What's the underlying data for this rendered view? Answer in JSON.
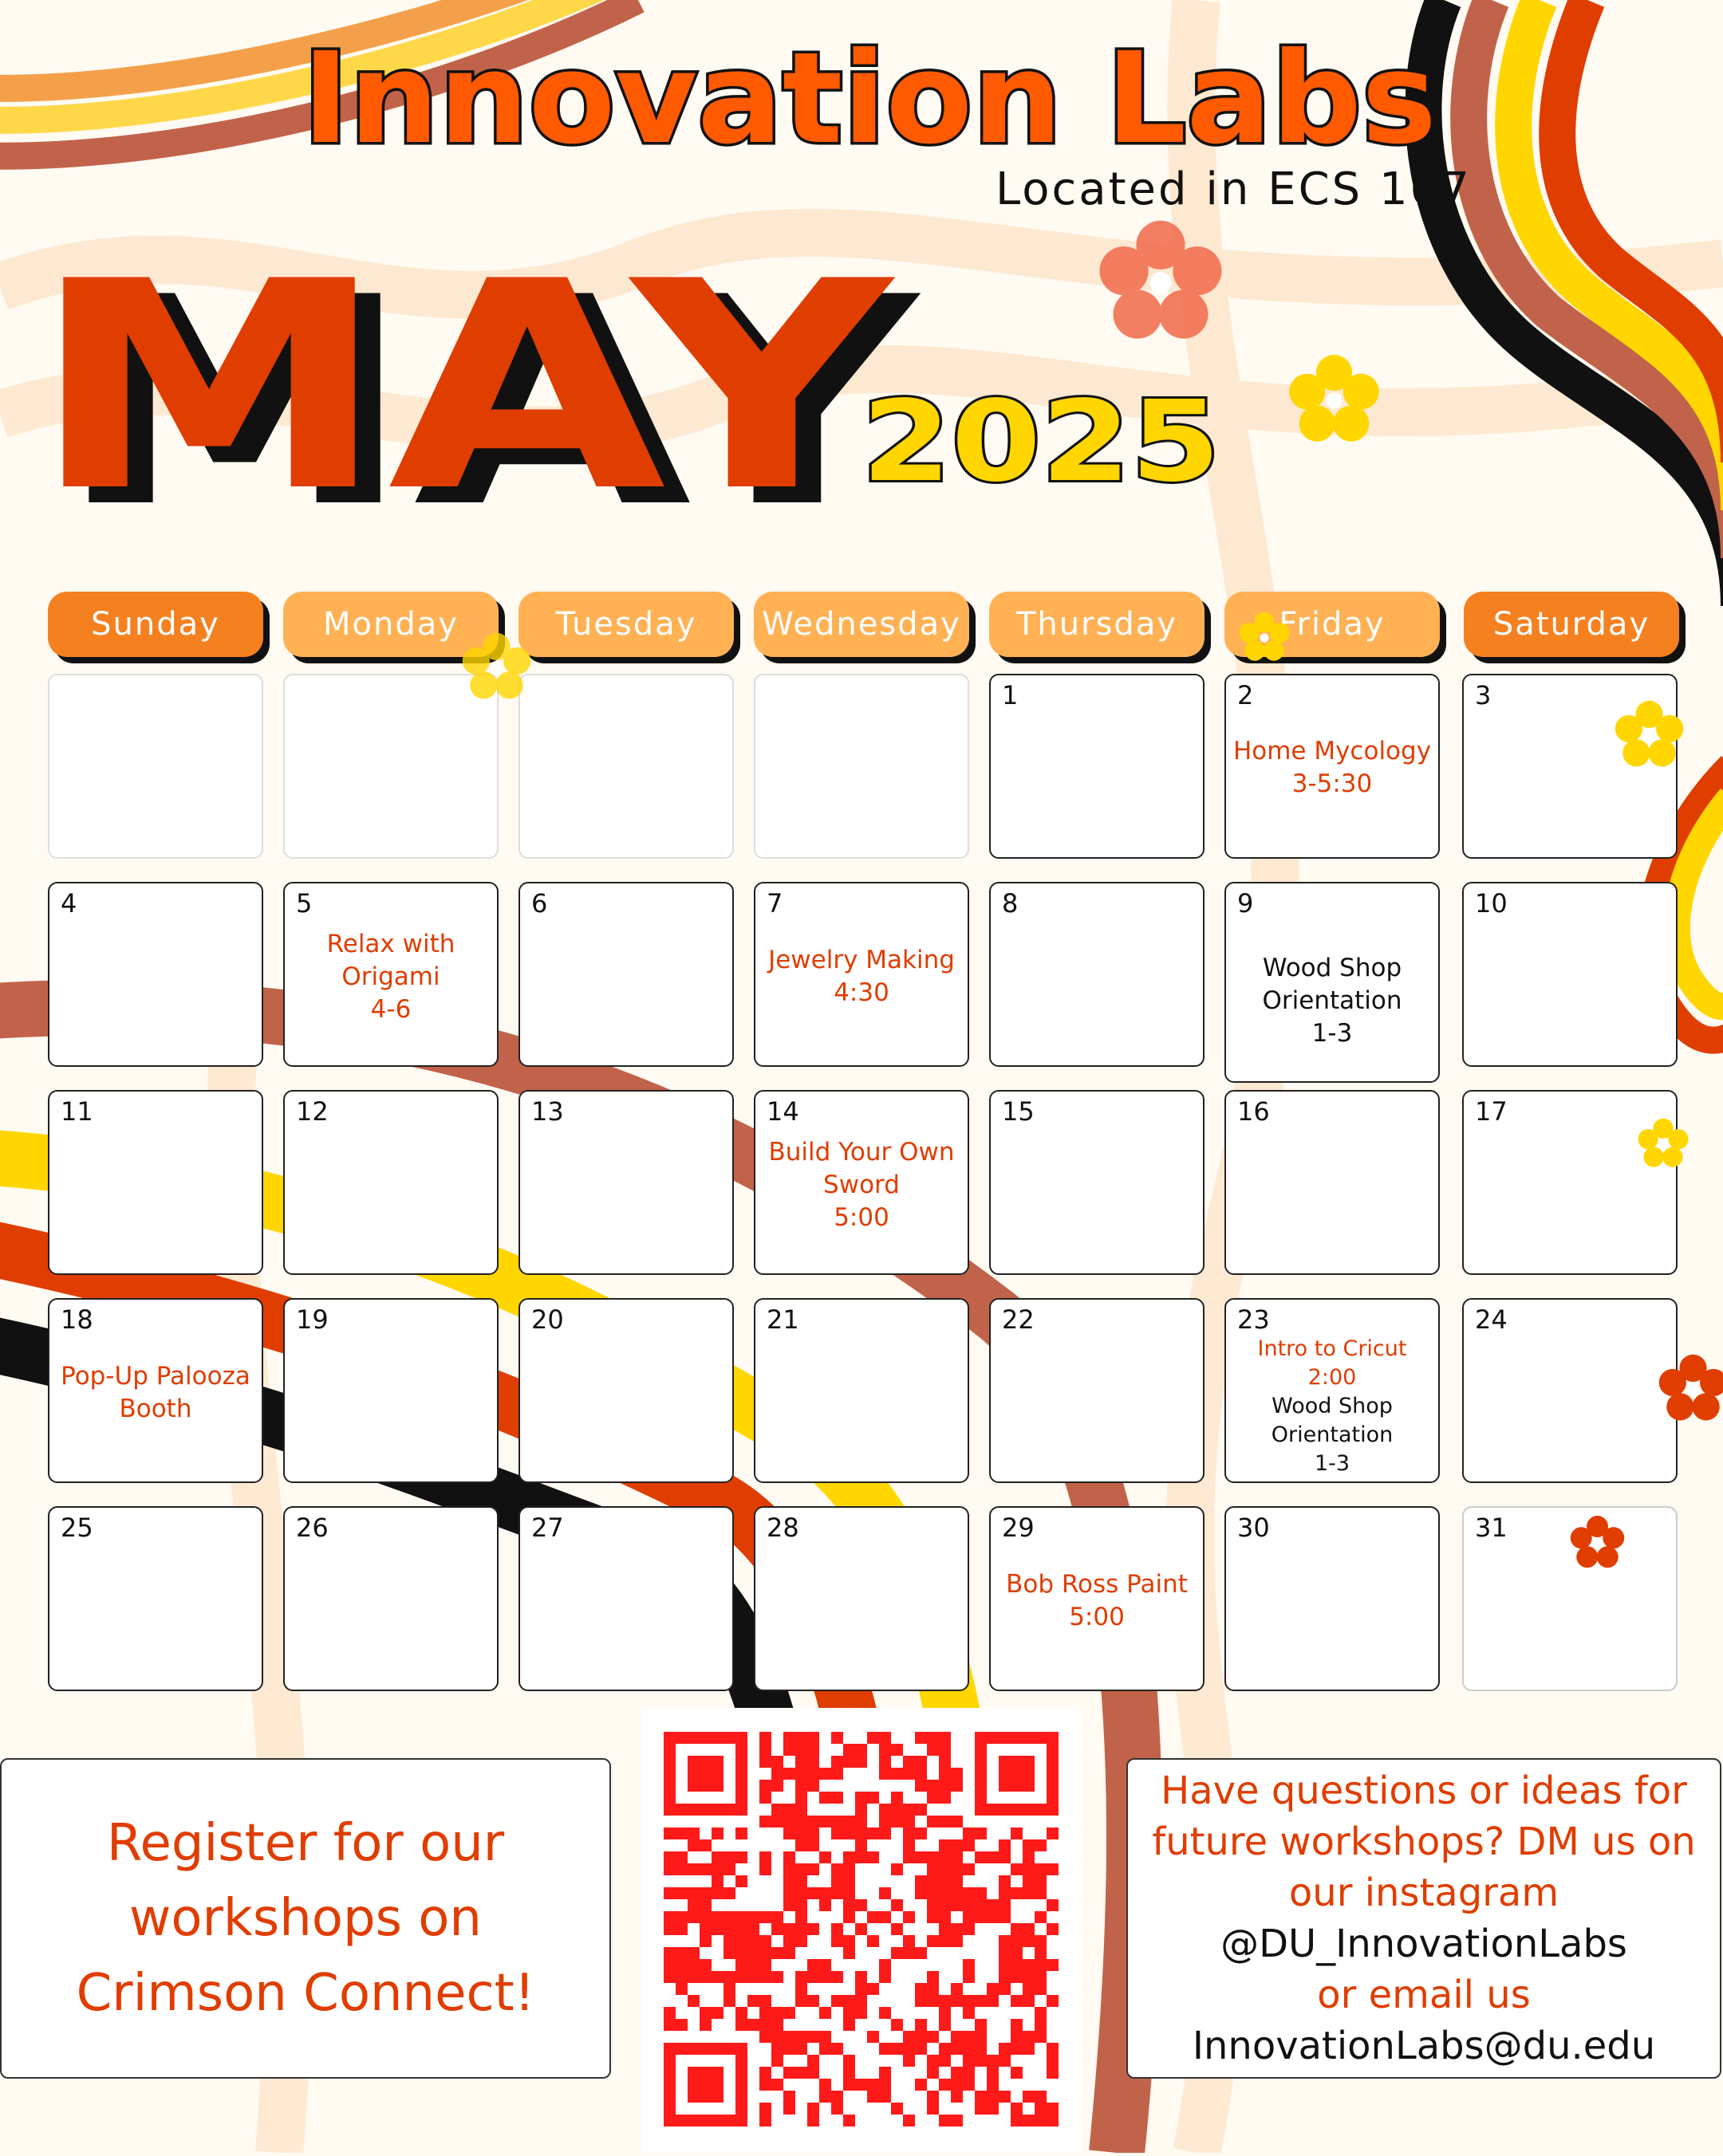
{
  "header": {
    "title": "Innovation Labs",
    "location": "Located in ECS 107",
    "month": "MAY",
    "year": "2025"
  },
  "colors": {
    "orange": "#ff5a00",
    "red_orange": "#e03d00",
    "yellow": "#ffd600",
    "brown": "#c1634a",
    "light_orange": "#ffb154",
    "header_orange": "#f58020"
  },
  "calendar": {
    "weekdays": [
      "Sunday",
      "Monday",
      "Tuesday",
      "Wednesday",
      "Thursday",
      "Friday",
      "Saturday"
    ],
    "days": [
      "1",
      "2",
      "3",
      "4",
      "5",
      "6",
      "7",
      "8",
      "9",
      "10",
      "11",
      "12",
      "13",
      "14",
      "15",
      "16",
      "17",
      "18",
      "19",
      "20",
      "21",
      "22",
      "23",
      "24",
      "25",
      "26",
      "27",
      "28",
      "29",
      "30",
      "31"
    ],
    "events": {
      "d2": "Home Mycology\n3-5:30",
      "d5": "Relax with\nOrigami\n4-6",
      "d7": "Jewelry Making\n4:30",
      "d9": "Wood Shop\nOrientation\n1-3",
      "d14": "Build Your Own\nSword\n5:00",
      "d18": "Pop-Up Palooza\nBooth",
      "d23a": "Intro to Cricut\n2:00",
      "d23b": "Wood Shop\nOrientation\n1-3",
      "d29": "Bob Ross Paint\n5:00"
    }
  },
  "register": {
    "text": "Register for our workshops on Crimson Connect!"
  },
  "contact": {
    "line1": "Have questions or ideas for future workshops? DM us on our instagram",
    "handle": "@DU_InnovationLabs",
    "line2": "or email us",
    "email": "InnovationLabs@du.edu"
  }
}
